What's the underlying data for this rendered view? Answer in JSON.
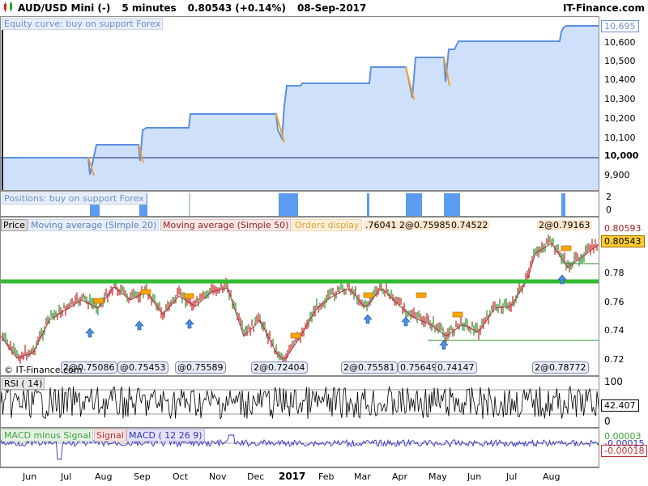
{
  "header": {
    "title": "AUD/USD Mini (-)",
    "timeframe": "5 minutes",
    "price": "0.80543",
    "change": "(+0.14%)",
    "date": "08-Sep-2017",
    "brand": "IT-Finance.com"
  },
  "equity": {
    "title": "Equity curve: buy on support Forex",
    "axis_labels": [
      "10,695",
      "10,600",
      "10,500",
      "10,400",
      "10,300",
      "10,200",
      "10,100",
      "10,000",
      "9,900"
    ],
    "current": "10,695"
  },
  "positions": {
    "title": "Positions: buy on support Forex",
    "axis_labels": [
      "2",
      "0"
    ]
  },
  "price": {
    "title": "Price",
    "ma20": "Moving average (Simple 20)",
    "ma50": "Moving average (Simple 50)",
    "orders": "Orders display",
    "axis_labels": [
      "0.80593",
      "0.80543",
      "0.78",
      "0.76",
      "0.74",
      "0.72"
    ],
    "current": "0.80543",
    "top_orders": [
      ".76041",
      "2@0.75985",
      "0.74522",
      "2@0.79163"
    ],
    "bottom_orders": [
      "2@0.75086",
      "@0.75453",
      "@0.75589",
      "2@0.72404",
      "2@0.75581",
      "0.75649",
      "0.74147",
      "2@0.78772"
    ],
    "watermark": "© IT-Finance.com"
  },
  "rsi": {
    "title": "RSI ( 14)",
    "axis_labels": [
      "100",
      "42.407",
      "0"
    ],
    "current": "42.407"
  },
  "macd": {
    "title_main": "MACD minus Signal",
    "title_signal": "Signal",
    "title_macd": "MACD ( 12 26 9)",
    "axis_labels": [
      "0.00003",
      "-0.00015",
      "-0.00018"
    ]
  },
  "xaxis": {
    "months": [
      "Jun",
      "Jul",
      "Aug",
      "Sep",
      "Oct",
      "Nov",
      "Dec",
      "2017",
      "Feb",
      "Mar",
      "Apr",
      "May",
      "Jun",
      "Jul",
      "Aug"
    ]
  },
  "colors": {
    "equity_fill": "#cfe0fb",
    "equity_line": "#5b8fe0",
    "equity_drawdown": "#f0a030",
    "positions_bar": "#5b9cf0",
    "support_line": "#33bb33",
    "order_box": "#ffa500",
    "arrow": "#4a90e2",
    "macd_line": "#3030c0",
    "rsi_line": "#000000"
  }
}
